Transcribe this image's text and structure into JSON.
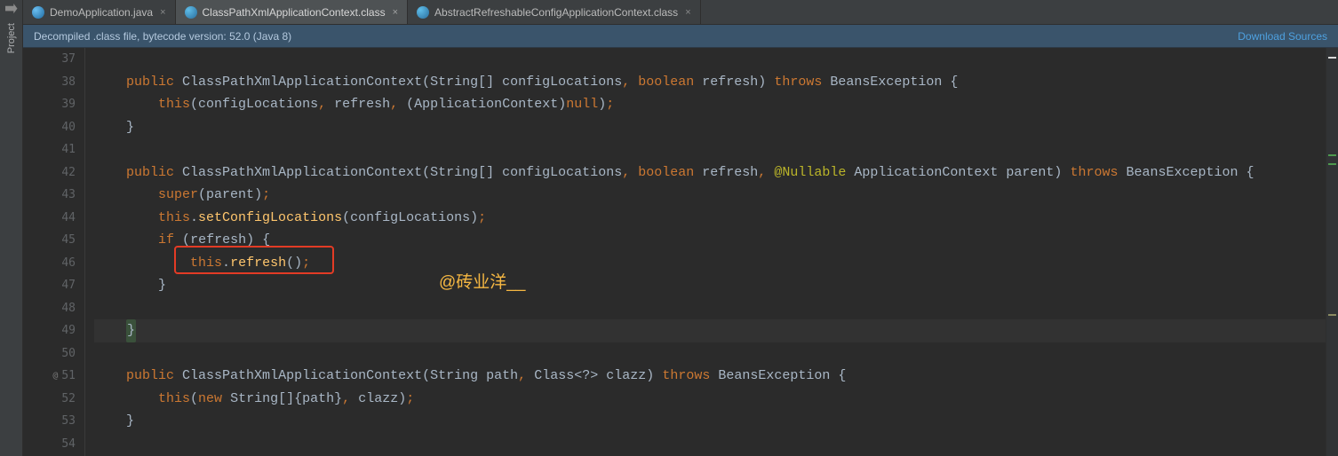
{
  "toolwindow": {
    "label": "Project"
  },
  "tabs": [
    {
      "label": "DemoApplication.java",
      "active": false
    },
    {
      "label": "ClassPathXmlApplicationContext.class",
      "active": true
    },
    {
      "label": "AbstractRefreshableConfigApplicationContext.class",
      "active": false
    }
  ],
  "info_bar": {
    "message": "Decompiled .class file, bytecode version: 52.0 (Java 8)",
    "action": "Download Sources"
  },
  "editor": {
    "first_line": 37,
    "last_line": 54,
    "active_line": 49,
    "gutter_markers": {
      "51": "@"
    },
    "lines": {
      "37": "",
      "38": "    public ClassPathXmlApplicationContext(String[] configLocations, boolean refresh) throws BeansException {",
      "39": "        this(configLocations, refresh, (ApplicationContext)null);",
      "40": "    }",
      "41": "",
      "42": "    public ClassPathXmlApplicationContext(String[] configLocations, boolean refresh, @Nullable ApplicationContext parent) throws BeansException {",
      "43": "        super(parent);",
      "44": "        this.setConfigLocations(configLocations);",
      "45": "        if (refresh) {",
      "46": "            this.refresh();",
      "47": "        }",
      "48": "",
      "49": "    }",
      "50": "",
      "51": "    public ClassPathXmlApplicationContext(String path, Class<?> clazz) throws BeansException {",
      "52": "        this(new String[]{path}, clazz);",
      "53": "    }",
      "54": ""
    },
    "highlight_box_line": 46,
    "highlight_box_text": "this.refresh();"
  },
  "watermark": "@砖业洋__"
}
